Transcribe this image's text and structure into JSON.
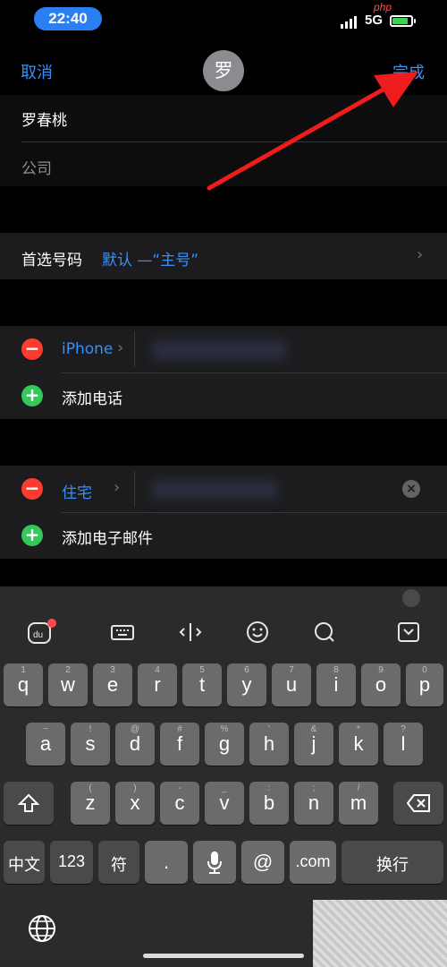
{
  "status_bar": {
    "time": "22:40",
    "network": "5G",
    "badge": "php"
  },
  "nav": {
    "cancel_label": "取消",
    "done_label": "完成",
    "avatar_initial": "罗"
  },
  "name_section": {
    "name": "罗春桃",
    "company_placeholder": "公司"
  },
  "preferred_number": {
    "label": "首选号码",
    "value": "默认 —“主号”"
  },
  "phone_section": {
    "phone_label": "iPhone",
    "add_phone_label": "添加电话"
  },
  "email_section": {
    "email_label": "住宅",
    "add_email_label": "添加电子邮件"
  },
  "keyboard": {
    "row1": [
      {
        "hint": "1",
        "key": "q"
      },
      {
        "hint": "2",
        "key": "w"
      },
      {
        "hint": "3",
        "key": "e"
      },
      {
        "hint": "4",
        "key": "r"
      },
      {
        "hint": "5",
        "key": "t"
      },
      {
        "hint": "6",
        "key": "y"
      },
      {
        "hint": "7",
        "key": "u"
      },
      {
        "hint": "8",
        "key": "i"
      },
      {
        "hint": "9",
        "key": "o"
      },
      {
        "hint": "0",
        "key": "p"
      }
    ],
    "row2": [
      {
        "hint": "~",
        "key": "a"
      },
      {
        "hint": "!",
        "key": "s"
      },
      {
        "hint": "@",
        "key": "d"
      },
      {
        "hint": "#",
        "key": "f"
      },
      {
        "hint": "%",
        "key": "g"
      },
      {
        "hint": "'",
        "key": "h"
      },
      {
        "hint": "&",
        "key": "j"
      },
      {
        "hint": "*",
        "key": "k"
      },
      {
        "hint": "?",
        "key": "l"
      }
    ],
    "row3": [
      {
        "hint": "(",
        "key": "z"
      },
      {
        "hint": ")",
        "key": "x"
      },
      {
        "hint": "-",
        "key": "c"
      },
      {
        "hint": "_",
        "key": "v"
      },
      {
        "hint": ":",
        "key": "b"
      },
      {
        "hint": ";",
        "key": "n"
      },
      {
        "hint": "/",
        "key": "m"
      }
    ],
    "bottom": {
      "chinese": "中文",
      "numbers": "123",
      "symbols": "符",
      "period": ".",
      "at": "@",
      "dotcom": ".com",
      "return": "换行"
    }
  }
}
